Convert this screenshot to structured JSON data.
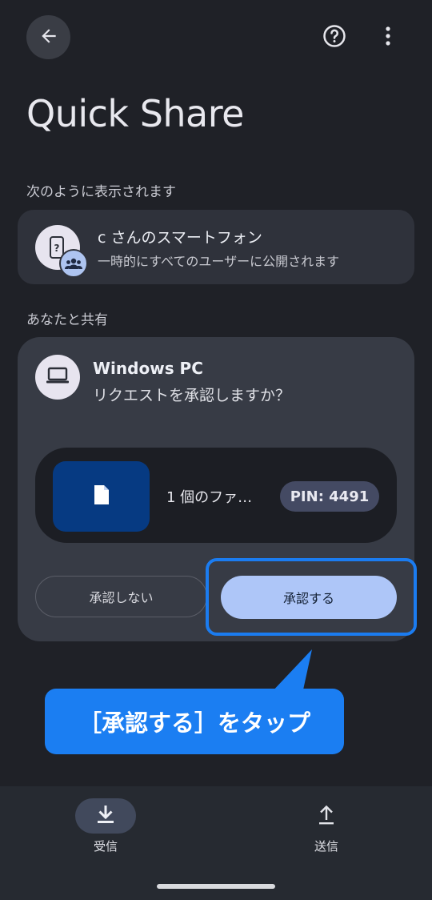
{
  "app": {
    "title": "Quick Share"
  },
  "header": {
    "back_icon": "arrow-left-icon",
    "help_icon": "help-circle-icon",
    "more_icon": "more-vert-icon"
  },
  "visibility": {
    "section_label": "次のように表示されます",
    "device_name": "c さんのスマートフォン",
    "visibility_text": "一時的にすべてのユーザーに公開されます"
  },
  "share": {
    "section_label": "あなたと共有",
    "sender_name": "Windows PC",
    "question": "リクエストを承認しますか？",
    "file_label": "1 個のファ…",
    "pin_text": "PIN: 4491",
    "decline_label": "承認しない",
    "accept_label": "承認する"
  },
  "callout": {
    "text": "［承認する］をタップ",
    "color": "#1b7ef2"
  },
  "bottom_nav": {
    "receive_label": "受信",
    "send_label": "送信"
  }
}
